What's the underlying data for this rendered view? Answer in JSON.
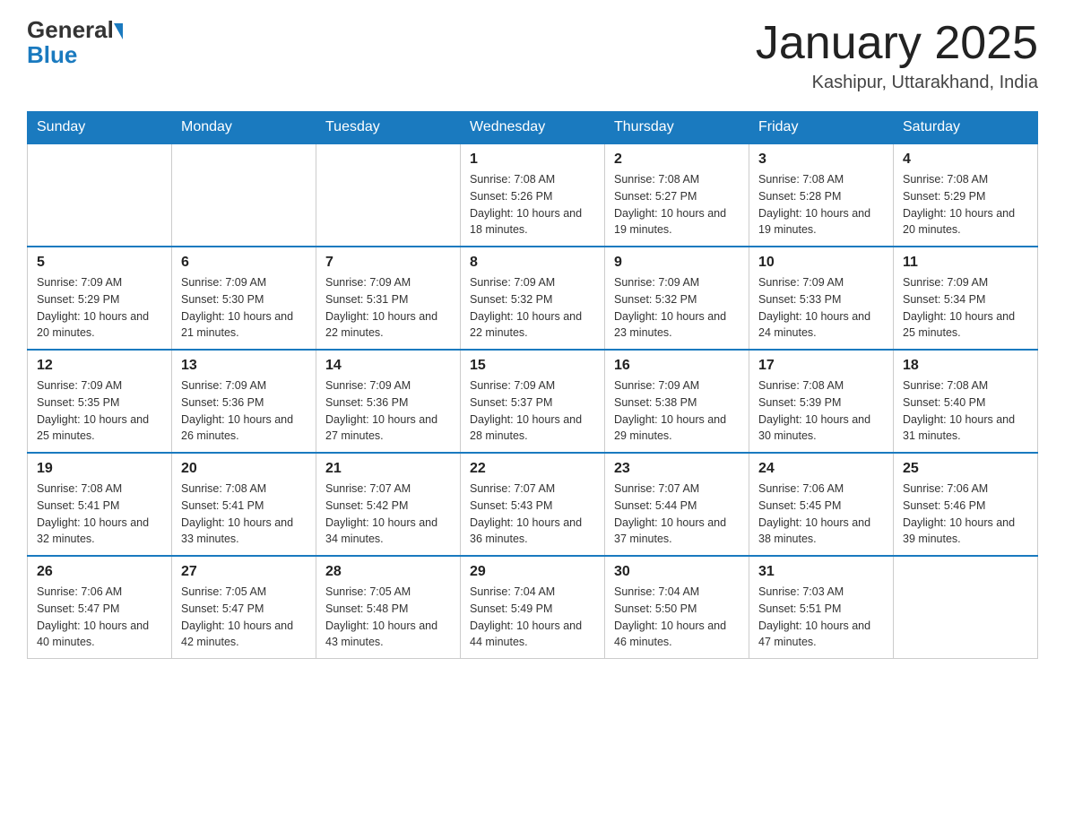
{
  "header": {
    "logo_general": "General",
    "logo_blue": "Blue",
    "month_title": "January 2025",
    "location": "Kashipur, Uttarakhand, India"
  },
  "days_of_week": [
    "Sunday",
    "Monday",
    "Tuesday",
    "Wednesday",
    "Thursday",
    "Friday",
    "Saturday"
  ],
  "weeks": [
    [
      null,
      null,
      null,
      {
        "day": "1",
        "sunrise": "Sunrise: 7:08 AM",
        "sunset": "Sunset: 5:26 PM",
        "daylight": "Daylight: 10 hours and 18 minutes."
      },
      {
        "day": "2",
        "sunrise": "Sunrise: 7:08 AM",
        "sunset": "Sunset: 5:27 PM",
        "daylight": "Daylight: 10 hours and 19 minutes."
      },
      {
        "day": "3",
        "sunrise": "Sunrise: 7:08 AM",
        "sunset": "Sunset: 5:28 PM",
        "daylight": "Daylight: 10 hours and 19 minutes."
      },
      {
        "day": "4",
        "sunrise": "Sunrise: 7:08 AM",
        "sunset": "Sunset: 5:29 PM",
        "daylight": "Daylight: 10 hours and 20 minutes."
      }
    ],
    [
      {
        "day": "5",
        "sunrise": "Sunrise: 7:09 AM",
        "sunset": "Sunset: 5:29 PM",
        "daylight": "Daylight: 10 hours and 20 minutes."
      },
      {
        "day": "6",
        "sunrise": "Sunrise: 7:09 AM",
        "sunset": "Sunset: 5:30 PM",
        "daylight": "Daylight: 10 hours and 21 minutes."
      },
      {
        "day": "7",
        "sunrise": "Sunrise: 7:09 AM",
        "sunset": "Sunset: 5:31 PM",
        "daylight": "Daylight: 10 hours and 22 minutes."
      },
      {
        "day": "8",
        "sunrise": "Sunrise: 7:09 AM",
        "sunset": "Sunset: 5:32 PM",
        "daylight": "Daylight: 10 hours and 22 minutes."
      },
      {
        "day": "9",
        "sunrise": "Sunrise: 7:09 AM",
        "sunset": "Sunset: 5:32 PM",
        "daylight": "Daylight: 10 hours and 23 minutes."
      },
      {
        "day": "10",
        "sunrise": "Sunrise: 7:09 AM",
        "sunset": "Sunset: 5:33 PM",
        "daylight": "Daylight: 10 hours and 24 minutes."
      },
      {
        "day": "11",
        "sunrise": "Sunrise: 7:09 AM",
        "sunset": "Sunset: 5:34 PM",
        "daylight": "Daylight: 10 hours and 25 minutes."
      }
    ],
    [
      {
        "day": "12",
        "sunrise": "Sunrise: 7:09 AM",
        "sunset": "Sunset: 5:35 PM",
        "daylight": "Daylight: 10 hours and 25 minutes."
      },
      {
        "day": "13",
        "sunrise": "Sunrise: 7:09 AM",
        "sunset": "Sunset: 5:36 PM",
        "daylight": "Daylight: 10 hours and 26 minutes."
      },
      {
        "day": "14",
        "sunrise": "Sunrise: 7:09 AM",
        "sunset": "Sunset: 5:36 PM",
        "daylight": "Daylight: 10 hours and 27 minutes."
      },
      {
        "day": "15",
        "sunrise": "Sunrise: 7:09 AM",
        "sunset": "Sunset: 5:37 PM",
        "daylight": "Daylight: 10 hours and 28 minutes."
      },
      {
        "day": "16",
        "sunrise": "Sunrise: 7:09 AM",
        "sunset": "Sunset: 5:38 PM",
        "daylight": "Daylight: 10 hours and 29 minutes."
      },
      {
        "day": "17",
        "sunrise": "Sunrise: 7:08 AM",
        "sunset": "Sunset: 5:39 PM",
        "daylight": "Daylight: 10 hours and 30 minutes."
      },
      {
        "day": "18",
        "sunrise": "Sunrise: 7:08 AM",
        "sunset": "Sunset: 5:40 PM",
        "daylight": "Daylight: 10 hours and 31 minutes."
      }
    ],
    [
      {
        "day": "19",
        "sunrise": "Sunrise: 7:08 AM",
        "sunset": "Sunset: 5:41 PM",
        "daylight": "Daylight: 10 hours and 32 minutes."
      },
      {
        "day": "20",
        "sunrise": "Sunrise: 7:08 AM",
        "sunset": "Sunset: 5:41 PM",
        "daylight": "Daylight: 10 hours and 33 minutes."
      },
      {
        "day": "21",
        "sunrise": "Sunrise: 7:07 AM",
        "sunset": "Sunset: 5:42 PM",
        "daylight": "Daylight: 10 hours and 34 minutes."
      },
      {
        "day": "22",
        "sunrise": "Sunrise: 7:07 AM",
        "sunset": "Sunset: 5:43 PM",
        "daylight": "Daylight: 10 hours and 36 minutes."
      },
      {
        "day": "23",
        "sunrise": "Sunrise: 7:07 AM",
        "sunset": "Sunset: 5:44 PM",
        "daylight": "Daylight: 10 hours and 37 minutes."
      },
      {
        "day": "24",
        "sunrise": "Sunrise: 7:06 AM",
        "sunset": "Sunset: 5:45 PM",
        "daylight": "Daylight: 10 hours and 38 minutes."
      },
      {
        "day": "25",
        "sunrise": "Sunrise: 7:06 AM",
        "sunset": "Sunset: 5:46 PM",
        "daylight": "Daylight: 10 hours and 39 minutes."
      }
    ],
    [
      {
        "day": "26",
        "sunrise": "Sunrise: 7:06 AM",
        "sunset": "Sunset: 5:47 PM",
        "daylight": "Daylight: 10 hours and 40 minutes."
      },
      {
        "day": "27",
        "sunrise": "Sunrise: 7:05 AM",
        "sunset": "Sunset: 5:47 PM",
        "daylight": "Daylight: 10 hours and 42 minutes."
      },
      {
        "day": "28",
        "sunrise": "Sunrise: 7:05 AM",
        "sunset": "Sunset: 5:48 PM",
        "daylight": "Daylight: 10 hours and 43 minutes."
      },
      {
        "day": "29",
        "sunrise": "Sunrise: 7:04 AM",
        "sunset": "Sunset: 5:49 PM",
        "daylight": "Daylight: 10 hours and 44 minutes."
      },
      {
        "day": "30",
        "sunrise": "Sunrise: 7:04 AM",
        "sunset": "Sunset: 5:50 PM",
        "daylight": "Daylight: 10 hours and 46 minutes."
      },
      {
        "day": "31",
        "sunrise": "Sunrise: 7:03 AM",
        "sunset": "Sunset: 5:51 PM",
        "daylight": "Daylight: 10 hours and 47 minutes."
      },
      null
    ]
  ]
}
